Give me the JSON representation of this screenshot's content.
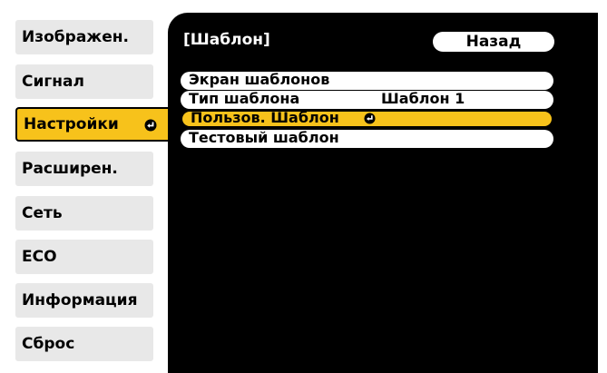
{
  "sidebar": {
    "items": [
      {
        "label": "Изображен."
      },
      {
        "label": "Сигнал"
      },
      {
        "label": "Настройки"
      },
      {
        "label": "Расширен."
      },
      {
        "label": "Сеть"
      },
      {
        "label": "ECO"
      },
      {
        "label": "Информация"
      },
      {
        "label": "Сброс"
      }
    ],
    "active_index": 2
  },
  "panel": {
    "title": "[Шаблон]",
    "back_label": "Назад",
    "items": [
      {
        "label": "Экран шаблонов",
        "value": ""
      },
      {
        "label": "Тип шаблона",
        "value": "Шаблон 1"
      },
      {
        "label": "Пользов. Шаблон",
        "value": ""
      },
      {
        "label": "Тестовый шаблон",
        "value": ""
      }
    ],
    "selected_index": 2
  },
  "colors": {
    "highlight": "#f7c21b",
    "tab_bg": "#e8e8e8",
    "panel_bg": "#000000"
  },
  "icons": {
    "enter": "enter-icon"
  }
}
